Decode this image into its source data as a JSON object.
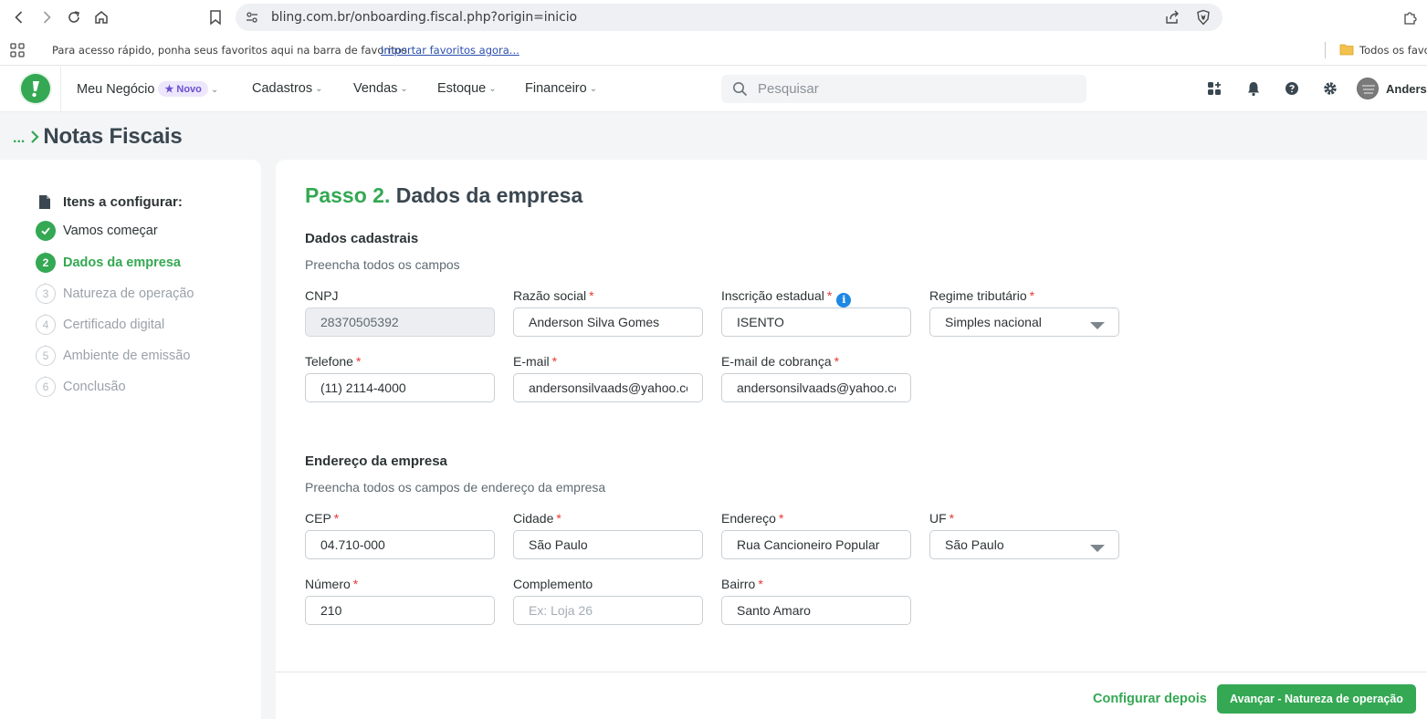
{
  "browser": {
    "url": "bling.com.br/onboarding.fiscal.php?origin=inicio",
    "bookmarks_prompt": "Para acesso rápido, ponha seus favoritos aqui na barra de favoritos.",
    "bookmarks_import_link": "Importar favoritos agora...",
    "bookmarks_folder": "Todos os favo"
  },
  "header": {
    "menu": [
      {
        "label": "Meu Negócio",
        "badge": "Novo"
      },
      {
        "label": "Cadastros"
      },
      {
        "label": "Vendas"
      },
      {
        "label": "Estoque"
      },
      {
        "label": "Financeiro"
      }
    ],
    "search_placeholder": "Pesquisar",
    "user_name": "Anderso"
  },
  "breadcrumb": {
    "ellipsis": "...",
    "title": "Notas Fiscais"
  },
  "stepper": {
    "heading": "Itens a configurar:",
    "steps": [
      {
        "number": "",
        "label": "Vamos começar",
        "state": "done"
      },
      {
        "number": "2",
        "label": "Dados da empresa",
        "state": "active"
      },
      {
        "number": "3",
        "label": "Natureza de operação",
        "state": "pending"
      },
      {
        "number": "4",
        "label": "Certificado digital",
        "state": "pending"
      },
      {
        "number": "5",
        "label": "Ambiente de emissão",
        "state": "pending"
      },
      {
        "number": "6",
        "label": "Conclusão",
        "state": "pending"
      }
    ]
  },
  "form": {
    "step_prefix": "Passo 2.",
    "title": "Dados da empresa",
    "section1": {
      "title": "Dados cadastrais",
      "subtitle": "Preencha todos os campos",
      "fields": {
        "cnpj": {
          "label": "CNPJ",
          "value": "28370505392"
        },
        "razao_social": {
          "label": "Razão social",
          "value": "Anderson Silva Gomes"
        },
        "inscricao_estadual": {
          "label": "Inscrição estadual",
          "value": "ISENTO"
        },
        "regime_tributario": {
          "label": "Regime tributário",
          "value": "Simples nacional"
        },
        "telefone": {
          "label": "Telefone",
          "value": "(11) 2114-4000"
        },
        "email": {
          "label": "E-mail",
          "value": "andersonsilvaads@yahoo.com."
        },
        "email_cobranca": {
          "label": "E-mail de cobrança",
          "value": "andersonsilvaads@yahoo.com."
        }
      }
    },
    "section2": {
      "title": "Endereço da empresa",
      "subtitle": "Preencha todos os campos de endereço da empresa",
      "fields": {
        "cep": {
          "label": "CEP",
          "value": "04.710-000"
        },
        "cidade": {
          "label": "Cidade",
          "value": "São Paulo"
        },
        "endereco": {
          "label": "Endereço",
          "value": "Rua Cancioneiro Popular"
        },
        "uf": {
          "label": "UF",
          "value": "São Paulo"
        },
        "numero": {
          "label": "Número",
          "value": "210"
        },
        "complemento": {
          "label": "Complemento",
          "placeholder": "Ex: Loja 26"
        },
        "bairro": {
          "label": "Bairro",
          "value": "Santo Amaro"
        }
      }
    },
    "actions": {
      "later": "Configurar depois",
      "next": "Avançar - Natureza de operação"
    }
  },
  "colors": {
    "brand_green": "#34a853",
    "required_red": "#e53935",
    "info_blue": "#1e88e5"
  }
}
